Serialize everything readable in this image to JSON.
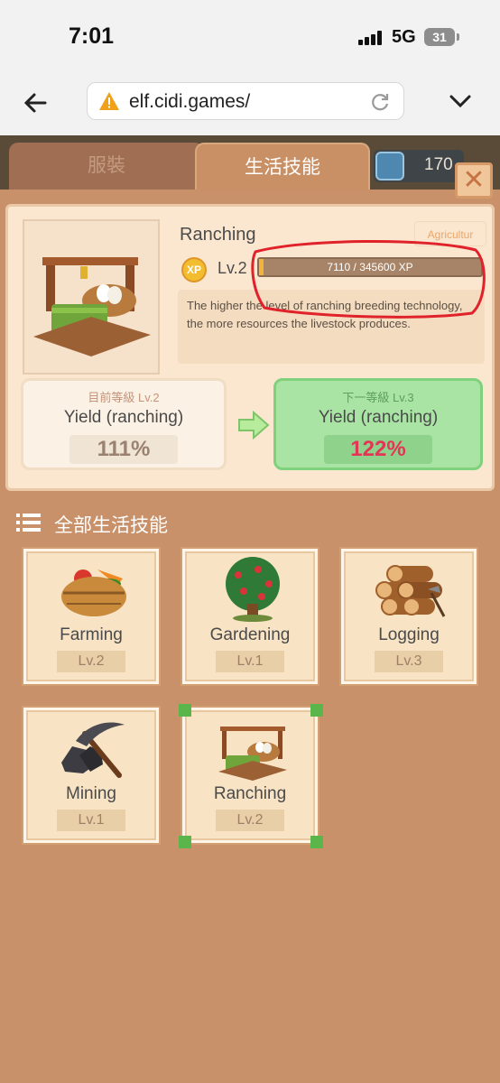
{
  "status_bar": {
    "time": "7:01",
    "network": "5G",
    "battery": "31"
  },
  "browser": {
    "url": "elf.cidi.games/"
  },
  "tabs": [
    {
      "label": "服裝"
    },
    {
      "label": "生活技能"
    }
  ],
  "currency": {
    "count": "170"
  },
  "detail": {
    "name": "Ranching",
    "tag": "Agricultur",
    "xp_badge": "XP",
    "level": "Lv.2",
    "xp_text": "7110 / 345600 XP",
    "xp_progress": 0.0206,
    "description": "The higher the level of ranching breeding technology, the more resources the livestock produces.",
    "current": {
      "caption": "目前等級 Lv.2",
      "name": "Yield (ranching)",
      "value": "111%"
    },
    "next": {
      "caption": "下一等級 Lv.3",
      "name": "Yield (ranching)",
      "value": "122%"
    }
  },
  "section_title": "全部生活技能",
  "skills": [
    {
      "name": "Farming",
      "level": "Lv.2",
      "icon": "vegetable-basket-icon"
    },
    {
      "name": "Gardening",
      "level": "Lv.1",
      "icon": "apple-tree-icon"
    },
    {
      "name": "Logging",
      "level": "Lv.3",
      "icon": "log-pile-icon"
    },
    {
      "name": "Mining",
      "level": "Lv.1",
      "icon": "pickaxe-coal-icon"
    },
    {
      "name": "Ranching",
      "level": "Lv.2",
      "icon": "hay-eggs-icon",
      "selected": true
    }
  ],
  "colors": {
    "accent_green": "#7fd17c",
    "next_value_red": "#e33656",
    "background": "#c8916a"
  }
}
